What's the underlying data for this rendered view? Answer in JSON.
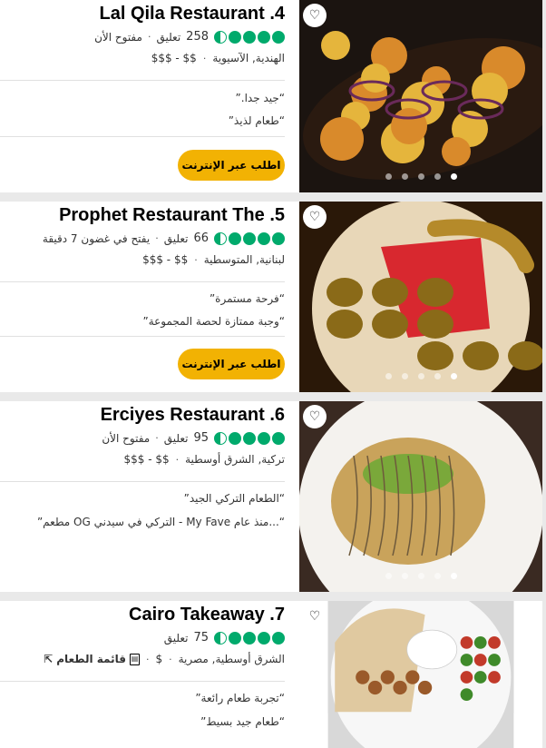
{
  "restaurants": [
    {
      "title": "Lal Qila Restaurant .4",
      "rating": 4.5,
      "review_count": "258",
      "review_word": "تعليق",
      "status": "مفتوح الأن",
      "cuisines": "الهندية, الآسيوية",
      "price": "$$ - $$$",
      "quotes": [
        "“جيد جدا.”",
        "“طعام لذيذ”"
      ],
      "order_label": "اطلب عبر الإنترنت",
      "photo_index": 5,
      "photo_count": 5,
      "colors": {
        "bg": "#1b1410",
        "plate": "#2a1a10",
        "food1": "#d98a2b",
        "food2": "#e5b53c",
        "accent": "#6a2a5a"
      }
    },
    {
      "title": "Prophet Restaurant The .5",
      "rating": 4.5,
      "review_count": "66",
      "review_word": "تعليق",
      "status": "يفتح في غضون 7 دقيقة",
      "cuisines": "لبنانية, المتوسطية",
      "price": "$$ - $$$",
      "quotes": [
        "“فرحة مستمرة”",
        "“وجبة ممتازة لحصة المجموعة”"
      ],
      "order_label": "اطلب عبر الإنترنت",
      "photo_index": 5,
      "photo_count": 5,
      "colors": {
        "bg": "#2a1808",
        "plate": "#e8d7b8",
        "food1": "#d8282f",
        "food2": "#8a6a18",
        "accent": "#b58a2a"
      }
    },
    {
      "title": "Erciyes Restaurant .6",
      "rating": 4.5,
      "review_count": "95",
      "review_word": "تعليق",
      "status": "مفتوح الأن",
      "cuisines": "تركية, الشرق أوسطية",
      "price": "$$ - $$$",
      "quotes": [
        "“الطعام التركي الجيد”",
        "“...منذ عام My Fave - التركي في سيدني OG مطعم”"
      ],
      "photo_index": 5,
      "photo_count": 5,
      "colors": {
        "bg": "#3a2a22",
        "plate": "#f4f2ee",
        "food1": "#c9a35b",
        "food2": "#7aa83a",
        "accent": "#6e5a3c"
      }
    },
    {
      "title": "Cairo Takeaway .7",
      "rating": 4.5,
      "review_count": "75",
      "review_word": "تعليق",
      "cuisines": "الشرق أوسطية, مصرية",
      "price": "$",
      "menu_label": "قائمة الطعام",
      "quotes": [
        "“تجربة طعام رائعة”",
        "“طعام جيد بسيط”"
      ],
      "colors": {
        "bg": "#d8d8d8",
        "plate": "#f7f7f7",
        "food1": "#e0c9a0",
        "food2": "#3f8a2a",
        "accent": "#c23a2a"
      }
    }
  ]
}
